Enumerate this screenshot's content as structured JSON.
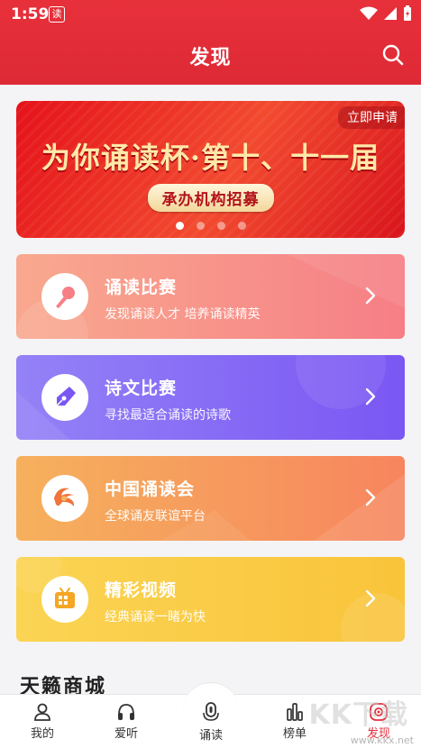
{
  "status": {
    "time": "1:59",
    "app_badge": "读"
  },
  "header": {
    "title": "发现"
  },
  "banner": {
    "apply_label": "立即申请",
    "headline": "为你诵读杯·第十、十一届",
    "subline": "承办机构招募",
    "dots_total": 4,
    "active_dot": 1
  },
  "cards": [
    {
      "title": "诵读比赛",
      "subtitle": "发现诵读人才  培养诵读精英",
      "icon": "microphone-icon",
      "color": "#f67f86"
    },
    {
      "title": "诗文比赛",
      "subtitle": "寻找最适合诵读的诗歌",
      "icon": "pen-nib-icon",
      "color": "#7a57f3"
    },
    {
      "title": "中国诵读会",
      "subtitle": "全球诵友联谊平台",
      "icon": "swirl-logo-icon",
      "color": "#f7855e"
    },
    {
      "title": "精彩视频",
      "subtitle": "经典诵读一睹为快",
      "icon": "tv-icon",
      "color": "#f9c43a"
    }
  ],
  "section": {
    "title": "天籁商城"
  },
  "tabs": [
    {
      "label": "我的",
      "icon": "user-icon"
    },
    {
      "label": "爱听",
      "icon": "headphones-icon"
    },
    {
      "label": "诵读",
      "icon": "microphone-icon"
    },
    {
      "label": "榜单",
      "icon": "bar-chart-icon"
    },
    {
      "label": "发现",
      "icon": "compass-icon",
      "active": true
    }
  ],
  "watermark": {
    "big": "KK下载",
    "url": "www.kkx.net"
  },
  "colors": {
    "brand": "#e62f3c"
  }
}
